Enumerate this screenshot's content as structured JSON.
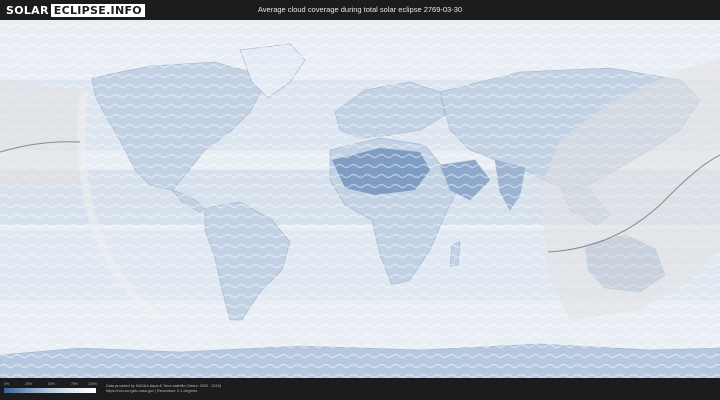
{
  "header": {
    "logo_part1": "SOLAR",
    "logo_part2": "ECLIPSE.INFO",
    "title": "Average cloud coverage during total solar eclipse 2769-03-30"
  },
  "map": {
    "ocean_color": "#e9eef5",
    "land_color": "#c9d6e6",
    "desert_color": "#7f9cc2",
    "eclipse_band_color": "#e2e2e2",
    "path_line_color": "#8a8a8a"
  },
  "legend": {
    "ticks": [
      "0%",
      "25%",
      "50%",
      "75%",
      "100%"
    ],
    "gradient": [
      "#3d5f8d",
      "#7d9bc0",
      "#b8cbe2",
      "#e2eaf4",
      "#ffffff"
    ]
  },
  "footer": {
    "credit_line1": "Data provided by NASA's Aqua & Terra satellite (Years: 2000 - 2019)",
    "credit_line2": "https://neo.sci.gsfc.nasa.gov | Resolution: 0.1 degrees"
  }
}
